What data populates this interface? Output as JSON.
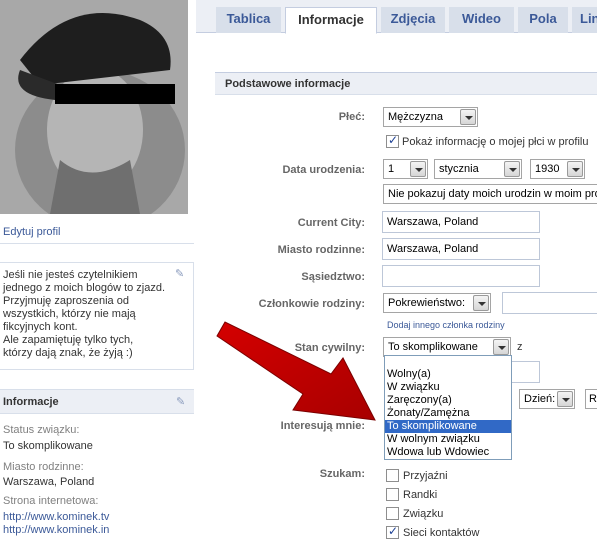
{
  "profile": {
    "edit_link": "Edytuj profil",
    "bio": "Jeśli nie jesteś czytelnikiem\njednego z moich blogów to zjazd.\nPrzyjmuję zaproszenia od\nwszystkich, którzy nie mają\nfikcyjnych kont.\nAle zapamiętuję tylko tych,\nktórzy dają znak, że żyją :)"
  },
  "info_box": {
    "title": "Informacje",
    "status_label": "Status związku:",
    "status_value": "To skomplikowane",
    "hometown_label": "Miasto rodzinne:",
    "hometown_value": "Warszawa, Poland",
    "website_label": "Strona internetowa:",
    "websites": [
      "http://www.kominek.tv",
      "http://www.kominek.in"
    ]
  },
  "tabs": [
    "Tablica",
    "Informacje",
    "Zdjęcia",
    "Wideo",
    "Pola",
    "Lin"
  ],
  "active_tab": "Informacje",
  "form": {
    "section_title": "Podstawowe informacje",
    "gender_label": "Płeć:",
    "gender_value": "Mężczyzna",
    "show_gender": "Pokaż informację o mojej płci w profilu",
    "birthdate_label": "Data urodzenia:",
    "birth_day": "1",
    "birth_month": "stycznia",
    "birth_year": "1930",
    "birthday_visibility": "Nie pokazuj daty moich urodzin w moim profilu",
    "current_city_label": "Current City:",
    "current_city": "Warszawa, Poland",
    "hometown_label": "Miasto rodzinne:",
    "hometown": "Warszawa, Poland",
    "neighborhood_label": "Sąsiedztwo:",
    "neighborhood": "",
    "family_label": "Członkowie rodziny:",
    "family_relation": "Pokrewieństwo:",
    "add_family": "Dodaj innego członka rodziny",
    "relationship_label": "Stan cywilny:",
    "relationship_value": "To skomplikowane",
    "relationship_with": "z",
    "anniversary_day": "Dzień:",
    "anniversary_more": "R",
    "interested_label": "Interesują mnie:",
    "looking_for_label": "Szukam:",
    "looking_for": [
      {
        "label": "Przyjaźni",
        "checked": false
      },
      {
        "label": "Randki",
        "checked": false
      },
      {
        "label": "Związku",
        "checked": false
      },
      {
        "label": "Sieci kontaktów",
        "checked": true
      }
    ]
  },
  "relationship_options": [
    "Wolny(a)",
    "W związku",
    "Zaręczony(a)",
    "Żonaty/Zamężna",
    "To skomplikowane",
    "W wolnym związku",
    "Wdowa lub Wdowiec"
  ],
  "selected_option": "To skomplikowane",
  "colors": {
    "link": "#3b5998",
    "highlight": "#3169c6",
    "arrow": "#c40000"
  }
}
